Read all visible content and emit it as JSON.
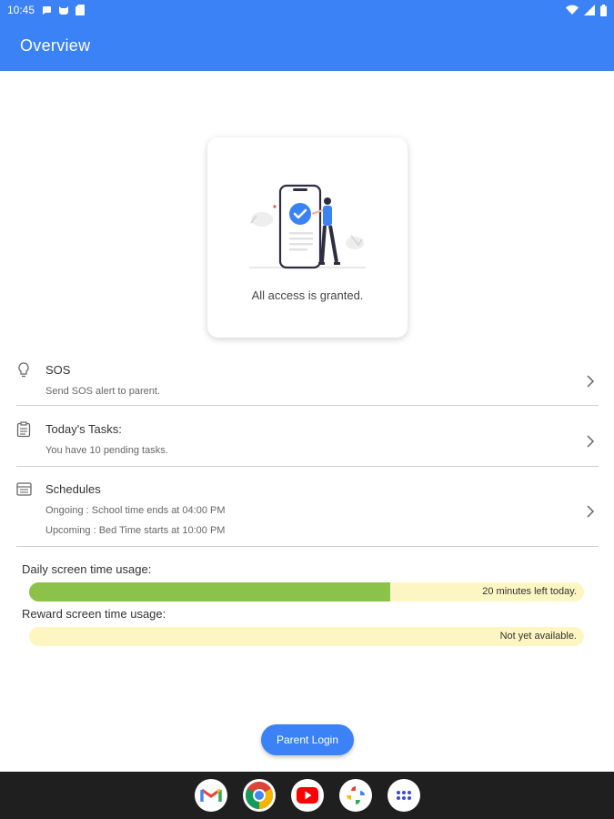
{
  "status_bar": {
    "time": "10:45"
  },
  "app_bar": {
    "title": "Overview"
  },
  "access_card": {
    "message": "All access is granted."
  },
  "menu": [
    {
      "title": "SOS",
      "lines": [
        "Send SOS alert to parent."
      ]
    },
    {
      "title": "Today's Tasks:",
      "lines": [
        "You have 10 pending tasks."
      ]
    },
    {
      "title": "Schedules",
      "lines": [
        "Ongoing : School time ends at 04:00 PM",
        "Upcoming : Bed Time starts at 10:00 PM"
      ]
    }
  ],
  "usage": {
    "daily": {
      "label": "Daily screen time usage:",
      "status": "20 minutes left today.",
      "used_fraction": 0.65
    },
    "reward": {
      "label": "Reward screen time usage:",
      "status": "Not yet available.",
      "used_fraction": 0
    }
  },
  "parent_login": {
    "label": "Parent Login"
  },
  "colors": {
    "primary": "#3b82f6",
    "progress_fill": "#8bc34a",
    "progress_track": "#fdf6c3"
  },
  "dock": [
    "gmail-icon",
    "chrome-icon",
    "youtube-icon",
    "photos-icon",
    "app-drawer-icon"
  ]
}
